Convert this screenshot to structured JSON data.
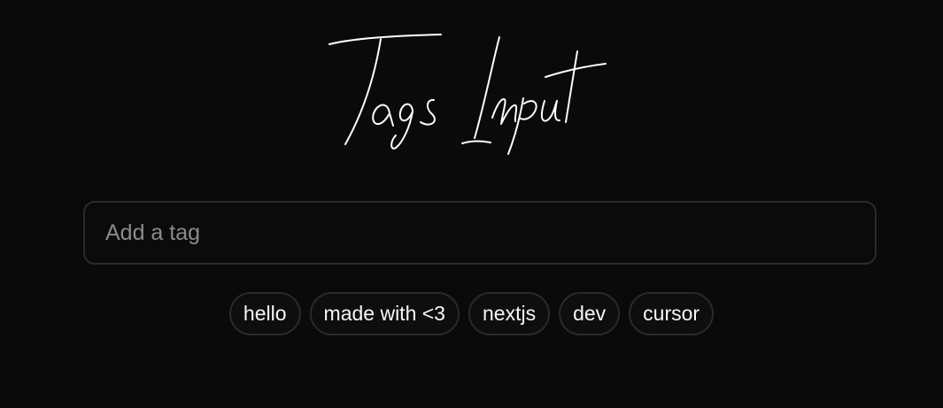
{
  "title": "Tags Input",
  "input": {
    "placeholder": "Add a tag",
    "value": ""
  },
  "tags": [
    {
      "label": "hello"
    },
    {
      "label": "made with <3"
    },
    {
      "label": "nextjs"
    },
    {
      "label": "dev"
    },
    {
      "label": "cursor"
    }
  ],
  "colors": {
    "background": "#0a0a0a",
    "border": "#2a2a2a",
    "text": "#f2f2f2",
    "placeholder": "#8b8b8b"
  }
}
